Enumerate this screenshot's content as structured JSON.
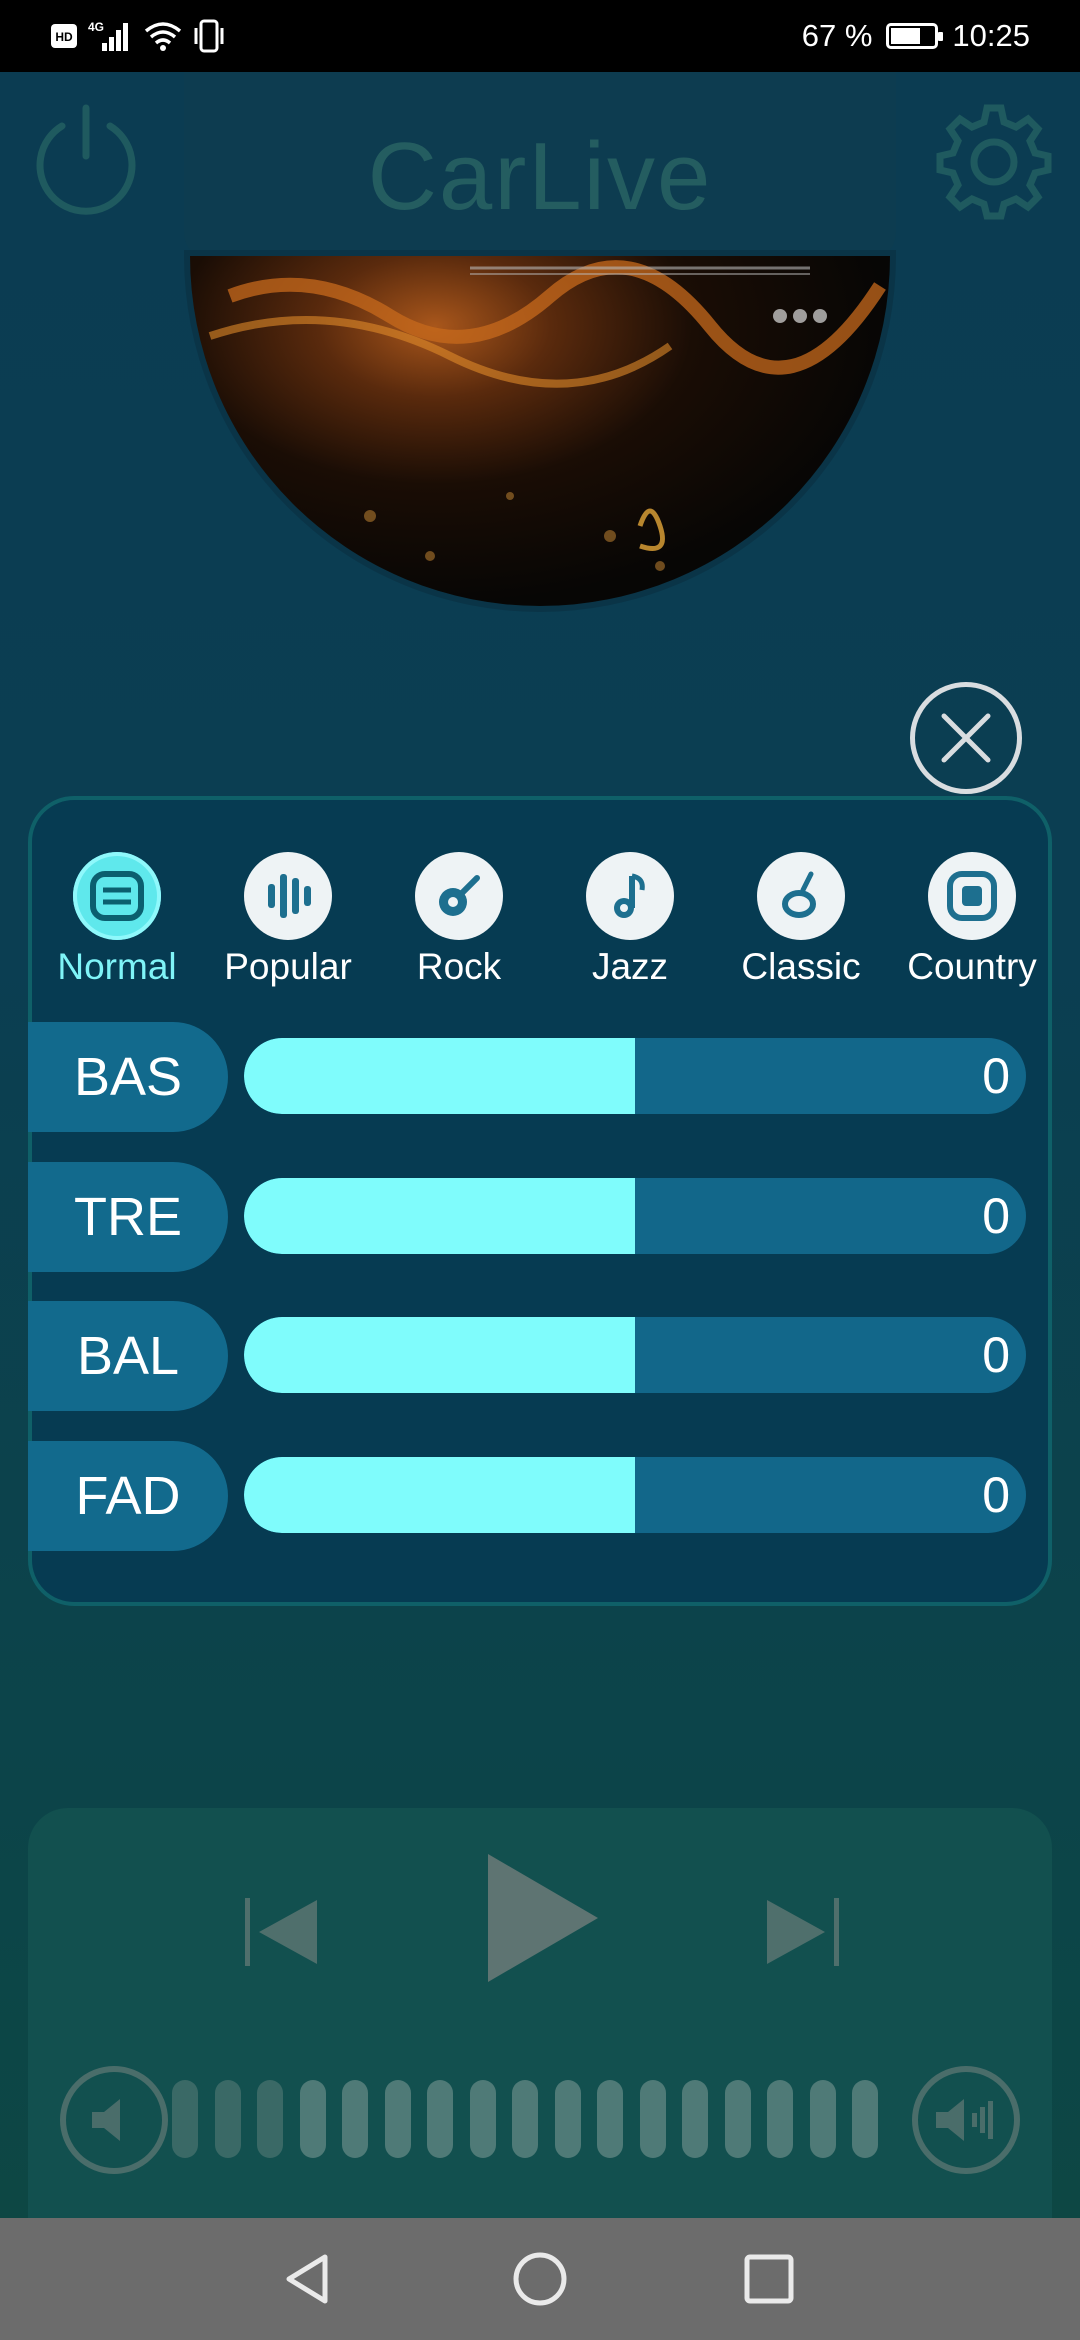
{
  "status_bar": {
    "battery_percent": "67 %",
    "time": "10:25",
    "network": "4G",
    "hd_label": "HD"
  },
  "app": {
    "title": "CarLive"
  },
  "eq": {
    "presets": [
      {
        "label": "Normal",
        "icon": "normal-preset-icon",
        "active": true
      },
      {
        "label": "Popular",
        "icon": "popular-preset-icon",
        "active": false
      },
      {
        "label": "Rock",
        "icon": "rock-preset-icon",
        "active": false
      },
      {
        "label": "Jazz",
        "icon": "jazz-preset-icon",
        "active": false
      },
      {
        "label": "Classic",
        "icon": "classic-preset-icon",
        "active": false
      },
      {
        "label": "Country",
        "icon": "country-preset-icon",
        "active": false
      }
    ],
    "sliders": [
      {
        "label": "BAS",
        "value": "0",
        "fill_fraction": 0.5
      },
      {
        "label": "TRE",
        "value": "0",
        "fill_fraction": 0.5
      },
      {
        "label": "BAL",
        "value": "0",
        "fill_fraction": 0.5
      },
      {
        "label": "FAD",
        "value": "0",
        "fill_fraction": 0.5
      }
    ]
  },
  "player": {
    "volume_level_fraction": 0.2,
    "volume_segments": 17
  },
  "colors": {
    "accent": "#7ffcfc",
    "panel": "#063b52",
    "track": "#12678a"
  }
}
